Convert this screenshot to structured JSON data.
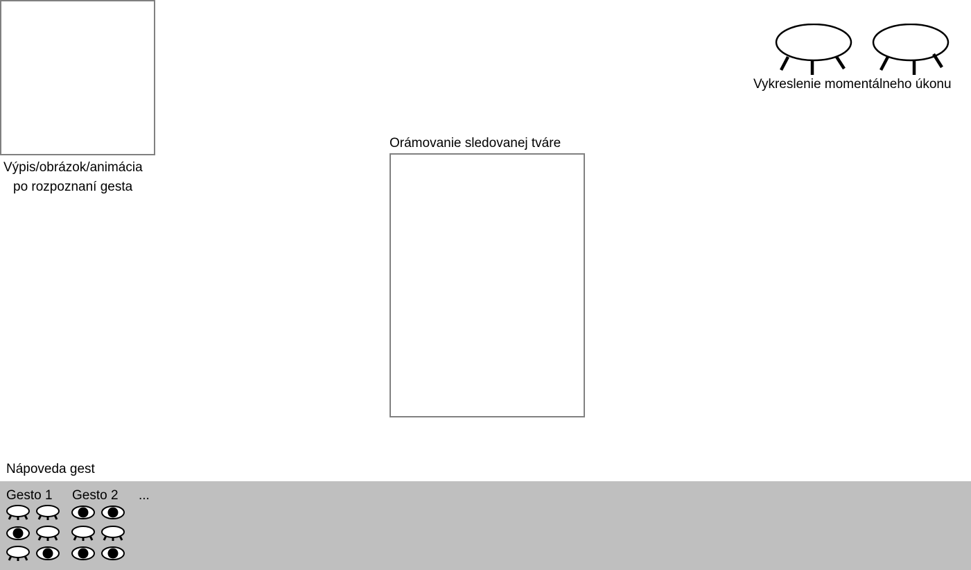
{
  "output_box": {
    "caption_line1": "Výpis/obrázok/animácia",
    "caption_line2": "po rozpoznaní gesta"
  },
  "face_box": {
    "caption": "Orámovanie sledovanej tváre"
  },
  "current_action": {
    "caption": "Vykreslenie momentálneho úkonu",
    "eyes": [
      "closed",
      "closed"
    ]
  },
  "help": {
    "title": "Nápoveda gest",
    "ellipsis": "...",
    "gestures": [
      {
        "name": "Gesto 1",
        "rows": [
          [
            "closed",
            "closed"
          ],
          [
            "open",
            "closed"
          ],
          [
            "closed",
            "open"
          ]
        ]
      },
      {
        "name": "Gesto 2",
        "rows": [
          [
            "open",
            "open"
          ],
          [
            "closed",
            "closed"
          ],
          [
            "open",
            "open"
          ]
        ]
      }
    ]
  }
}
